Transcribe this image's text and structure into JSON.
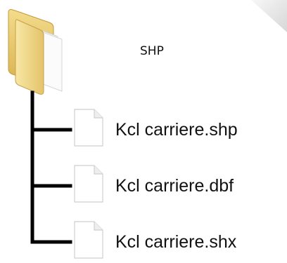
{
  "folder": {
    "name": "SHP",
    "icon": "folder-icon",
    "color": "#e8c86a"
  },
  "files": [
    {
      "name": "Kcl carriere.shp",
      "icon": "file-icon"
    },
    {
      "name": "Kcl carriere.dbf",
      "icon": "file-icon"
    },
    {
      "name": "Kcl carriere.shx",
      "icon": "file-icon"
    }
  ],
  "tree_line_color": "#000000"
}
